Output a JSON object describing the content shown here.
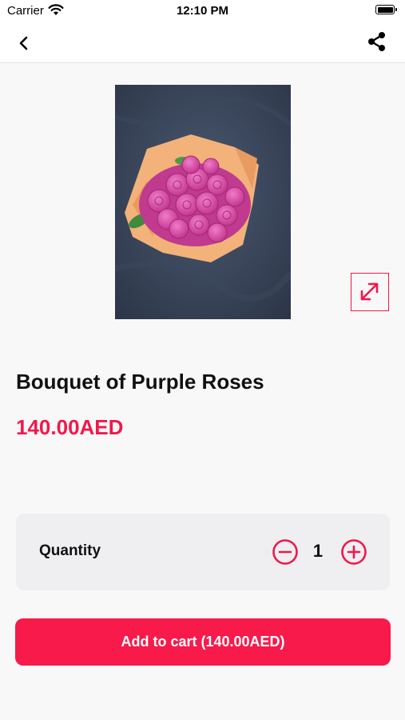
{
  "status_bar": {
    "carrier": "Carrier",
    "time": "12:10 PM",
    "icons": [
      "wifi-icon",
      "battery-icon"
    ]
  },
  "nav": {
    "back_icon": "chevron-left-icon",
    "share_icon": "share-icon"
  },
  "product": {
    "image_alt": "Bouquet of purple roses wrapped in peach paper",
    "expand_icon": "expand-diagonal-icon",
    "title": "Bouquet of Purple Roses",
    "price": "140.00AED"
  },
  "quantity": {
    "label": "Quantity",
    "value": "1",
    "decrement_icon": "minus-circle-icon",
    "increment_icon": "plus-circle-icon"
  },
  "cart": {
    "button_label": "Add to cart (140.00AED)"
  },
  "colors": {
    "accent": "#f71a4b",
    "background": "#f8f8f8",
    "card": "#efeff2"
  }
}
